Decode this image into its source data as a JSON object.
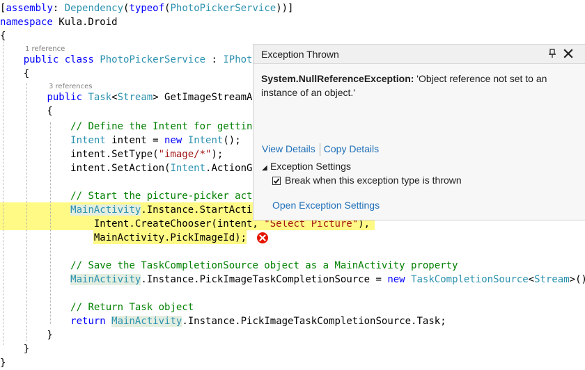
{
  "code": {
    "codelens": [
      "1 reference",
      "3 references"
    ],
    "lines": [
      [
        [
          "[",
          ""
        ],
        [
          "assembly",
          "kw"
        ],
        [
          ": ",
          ""
        ],
        [
          "Dependency",
          "ty"
        ],
        [
          "(",
          ""
        ],
        [
          "typeof",
          "kw"
        ],
        [
          "(",
          ""
        ],
        [
          "PhotoPickerService",
          "ty"
        ],
        [
          "))]",
          ""
        ]
      ],
      [
        [
          "namespace",
          "kw"
        ],
        [
          " Kula.Droid",
          ""
        ]
      ],
      [
        [
          "{",
          ""
        ]
      ],
      [
        [
          "    ",
          ""
        ],
        [
          "public",
          "kw"
        ],
        [
          " ",
          ""
        ],
        [
          "class",
          "kw"
        ],
        [
          " ",
          ""
        ],
        [
          "PhotoPickerService",
          "ty"
        ],
        [
          " : ",
          ""
        ],
        [
          "IPhot",
          "ty"
        ]
      ],
      [
        [
          "    {",
          ""
        ]
      ],
      [
        [
          "        ",
          ""
        ],
        [
          "public",
          "kw"
        ],
        [
          " ",
          ""
        ],
        [
          "Task",
          "ty"
        ],
        [
          "<",
          ""
        ],
        [
          "Stream",
          "ty"
        ],
        [
          "> GetImageStreamA",
          ""
        ]
      ],
      [
        [
          "        {",
          ""
        ]
      ],
      [
        [
          "            ",
          ""
        ],
        [
          "// Define the Intent for gettin",
          "cm"
        ]
      ],
      [
        [
          "            ",
          ""
        ],
        [
          "Intent",
          "ty"
        ],
        [
          " intent = ",
          ""
        ],
        [
          "new",
          "kw"
        ],
        [
          " ",
          ""
        ],
        [
          "Intent",
          "ty"
        ],
        [
          "();",
          ""
        ]
      ],
      [
        [
          "            intent.SetType(",
          ""
        ],
        [
          "\"image/*\"",
          "st"
        ],
        [
          ");",
          ""
        ]
      ],
      [
        [
          "            intent.SetAction(",
          ""
        ],
        [
          "Intent",
          "ty"
        ],
        [
          ".ActionG",
          ""
        ]
      ],
      [],
      [
        [
          "            ",
          ""
        ],
        [
          "// Start the picture-picker act",
          "cm"
        ]
      ],
      [
        [
          "            ",
          ""
        ],
        [
          "MainActivity",
          "ty-hl"
        ],
        [
          ".Instance.StartActi",
          ""
        ]
      ],
      [
        [
          "                Intent.CreateChooser(intent, ",
          ""
        ],
        [
          "\"Select Picture\"",
          "st"
        ],
        [
          "),",
          ""
        ]
      ],
      [
        [
          "                MainActivity.PickImageId);",
          ""
        ]
      ],
      [],
      [
        [
          "            ",
          ""
        ],
        [
          "// Save the TaskCompletionSource object as a MainActivity property",
          "cm"
        ]
      ],
      [
        [
          "            ",
          ""
        ],
        [
          "MainActivity",
          "ty-hl"
        ],
        [
          ".Instance.PickImageTaskCompletionSource = ",
          ""
        ],
        [
          "new",
          "kw"
        ],
        [
          " ",
          ""
        ],
        [
          "TaskCompletionSource",
          "ty"
        ],
        [
          "<",
          ""
        ],
        [
          "Stream",
          "ty"
        ],
        [
          ">();",
          ""
        ]
      ],
      [],
      [
        [
          "            ",
          ""
        ],
        [
          "// Return Task object",
          "cm"
        ]
      ],
      [
        [
          "            ",
          ""
        ],
        [
          "return",
          "kw"
        ],
        [
          " ",
          ""
        ],
        [
          "MainActivity",
          "ty-hl"
        ],
        [
          ".Instance.PickImageTaskCompletionSource.Task;",
          ""
        ]
      ],
      [
        [
          "        }",
          ""
        ]
      ],
      [
        [
          "    }",
          ""
        ]
      ],
      [
        [
          "}",
          ""
        ]
      ]
    ]
  },
  "popup": {
    "title": "Exception Thrown",
    "exception_type": "System.NullReferenceException:",
    "exception_message": "'Object reference not set to an instance of an object.'",
    "view_details": "View Details",
    "copy_details": "Copy Details",
    "settings_header": "Exception Settings",
    "break_label": "Break when this exception type is thrown",
    "break_checked": true,
    "open_settings": "Open Exception Settings",
    "icons": {
      "pin": "pin-icon",
      "close": "close-icon",
      "expander": "expander-triangle-icon"
    }
  },
  "markers": {
    "error_icon": "error-icon"
  },
  "colors": {
    "keyword": "#0000ff",
    "type": "#2b91af",
    "string": "#a31515",
    "comment": "#008000",
    "current_statement": "#fff985",
    "link": "#1e6fb8",
    "error": "#e51400"
  }
}
